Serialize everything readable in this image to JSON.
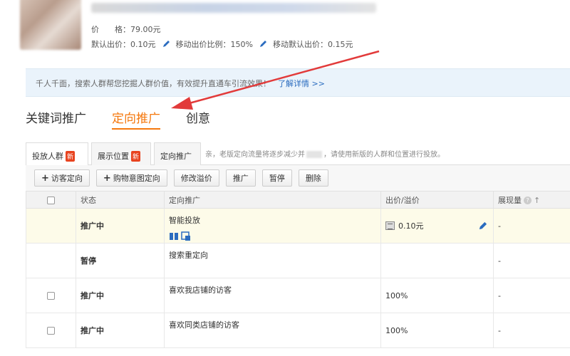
{
  "product": {
    "price_label": "价　　格：",
    "price_value": "79.00元",
    "default_bid_label": "默认出价：",
    "default_bid_value": "0.10元",
    "mobile_ratio_label": "移动出价比例：",
    "mobile_ratio_value": "150%",
    "mobile_default_label": "移动默认出价：",
    "mobile_default_value": "0.15元"
  },
  "notice": {
    "text": "千人千面，搜索人群帮您挖掘人群价值，有效提升直通车引流效果！",
    "link": "了解详情 >>"
  },
  "main_tabs": [
    {
      "label": "关键词推广",
      "active": false
    },
    {
      "label": "定向推广",
      "active": true
    },
    {
      "label": "创意",
      "active": false
    }
  ],
  "sub_tabs": [
    {
      "label": "投放人群",
      "badge": "新",
      "active": true
    },
    {
      "label": "展示位置",
      "badge": "新",
      "active": false
    },
    {
      "label": "定向推广",
      "badge": "",
      "active": false
    }
  ],
  "sub_note": {
    "before": "亲，老版定向流量将逐步减少并",
    "after": "，请使用新版的人群和位置进行投放。"
  },
  "toolbar": {
    "add_visitor": "访客定向",
    "add_cart": "购物意图定向",
    "edit_bid": "修改溢价",
    "promote": "推广",
    "pause": "暂停",
    "delete": "删除"
  },
  "table": {
    "headers": {
      "status": "状态",
      "target": "定向推广",
      "bid": "出价/溢价",
      "impressions": "展现量"
    },
    "rows": [
      {
        "status": "推广中",
        "status_type": "run",
        "target": "智能投放",
        "bid": "0.10元",
        "impressions": "-",
        "has_checkbox": false
      },
      {
        "status": "暂停",
        "status_type": "pause",
        "target": "搜索重定向",
        "bid": "",
        "impressions": "-",
        "has_checkbox": false
      },
      {
        "status": "推广中",
        "status_type": "run",
        "target": "喜欢我店铺的访客",
        "bid": "100%",
        "impressions": "-",
        "has_checkbox": true
      },
      {
        "status": "推广中",
        "status_type": "run",
        "target": "喜欢同类店铺的访客",
        "bid": "100%",
        "impressions": "-",
        "has_checkbox": true
      }
    ]
  },
  "colors": {
    "accent_orange": "#f5780e",
    "status_green": "#1a9a25",
    "arrow_red": "#e23a3a",
    "link_blue": "#2b6cbf",
    "badge_red": "#e8431f"
  }
}
